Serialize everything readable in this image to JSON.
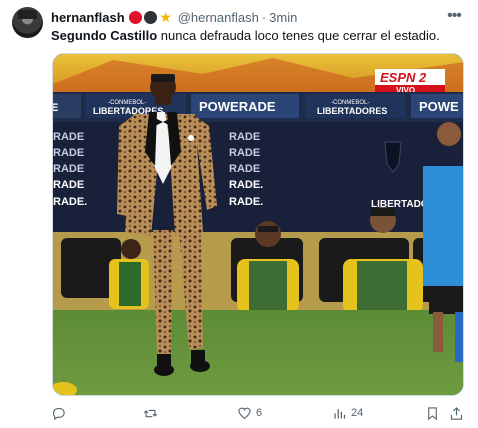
{
  "author": {
    "display_name": "hernanflash",
    "handle": "@hernanflash",
    "separator": "·",
    "time": "3min",
    "badge_colors": [
      "#e0112b",
      "#2f3336",
      "#f4b400"
    ]
  },
  "tweet": {
    "text_bold": "Segundo Castillo",
    "text_rest": " nunca defrauda loco tenes que cerrar el estadio."
  },
  "media": {
    "banner_powerade": "POWERADE",
    "banner_conmebol_top": "-CONMEBOL-",
    "banner_libertadores": "LIBERTADORES",
    "banner_powerade_short": "POWE",
    "left_board_lines": [
      "RADE",
      "RADE",
      "RADE",
      "RADE",
      "RADE."
    ],
    "mid_board_lines": [
      "RADE",
      "RADE",
      "RADE",
      "RADE.",
      "RADE."
    ],
    "libertador_label": "LIBERTADOR",
    "broadcaster": "ESPN 2",
    "live_label": "VIVO"
  },
  "actions": {
    "reply_count": "",
    "retweet_count": "",
    "like_count": "6",
    "views_count": "24"
  },
  "colors": {
    "accent_blue": "#1d9bf0",
    "muted": "#536471",
    "espn_red": "#d4111b"
  }
}
